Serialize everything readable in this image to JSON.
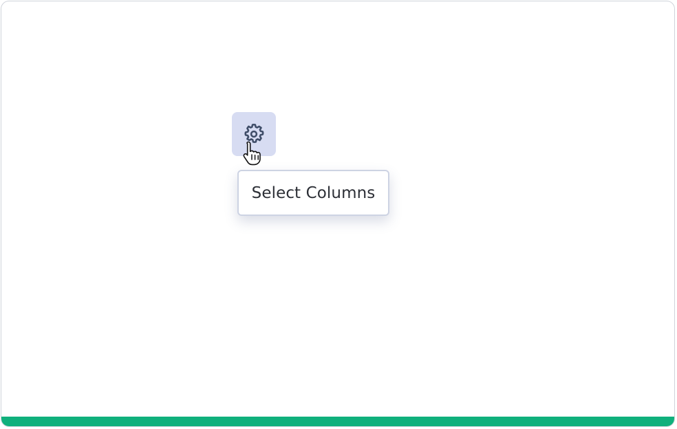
{
  "settings_button": {
    "icon": "gear-icon",
    "background": "#d7dcf2"
  },
  "tooltip": {
    "text": "Select Columns"
  },
  "cursor": {
    "icon": "hand-pointer-icon"
  },
  "colors": {
    "accent_bar": "#10b07c",
    "icon_stroke": "#3f4d68",
    "border": "#cfd3da"
  }
}
